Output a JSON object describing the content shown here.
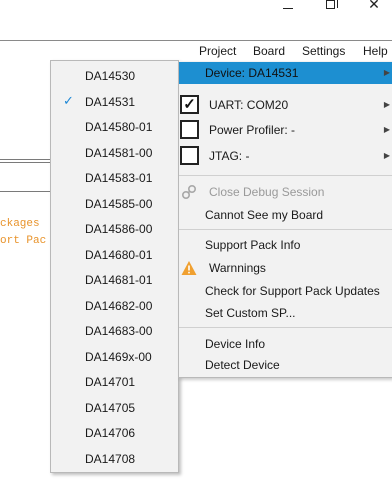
{
  "window": {
    "minimize_glyph": "",
    "close_glyph": "✕"
  },
  "menubar": {
    "items": [
      "Project",
      "Board",
      "Settings",
      "Help"
    ]
  },
  "background": {
    "code_lines": [
      "ckages",
      "ort Pac"
    ]
  },
  "device_list": {
    "selected": "DA14531",
    "items": [
      "DA14530",
      "DA14531",
      "DA14580-01",
      "DA14581-00",
      "DA14583-01",
      "DA14585-00",
      "DA14586-00",
      "DA14680-01",
      "DA14681-01",
      "DA14682-00",
      "DA14683-00",
      "DA1469x-00",
      "DA14701",
      "DA14705",
      "DA14706",
      "DA14708"
    ]
  },
  "board_menu": {
    "device": "Device: DA14531",
    "uart": "UART: COM20",
    "power_profiler": "Power Profiler: -",
    "jtag": "JTAG: -",
    "close_debug": "Close Debug Session",
    "cannot_see_board": "Cannot See my Board",
    "support_pack_info": "Support Pack Info",
    "warnings": "Warnnings",
    "check_updates": "Check for Support Pack Updates",
    "set_custom_sp": "Set Custom SP...",
    "device_info": "Device Info",
    "detect_device": "Detect Device"
  },
  "colors": {
    "highlight": "#1d8fd1",
    "check": "#1e88d6",
    "warning": "#f0a030",
    "code": "#e8932b"
  }
}
